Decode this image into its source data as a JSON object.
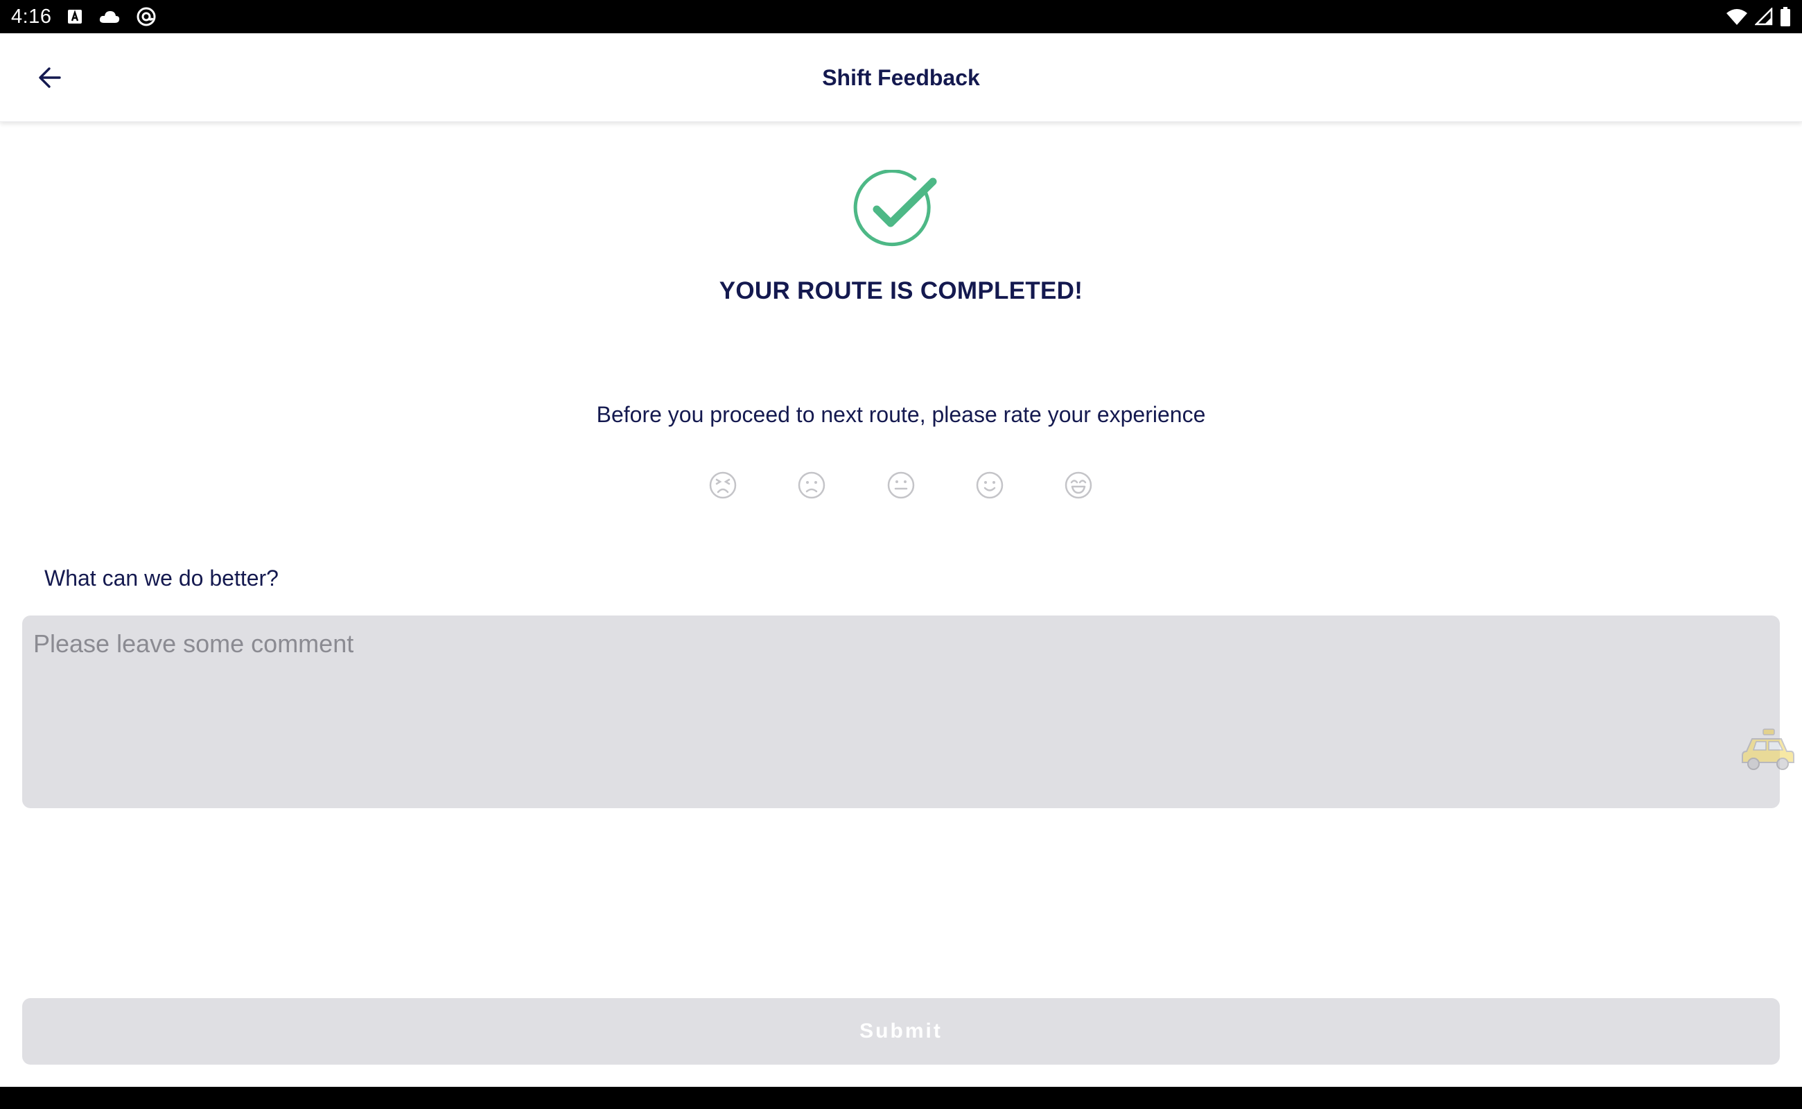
{
  "status_bar": {
    "time": "4:16",
    "left_icons": [
      "keyboard-a-icon",
      "cloud-icon",
      "at-sign-icon"
    ],
    "right_icons": [
      "wifi-icon",
      "signal-icon",
      "battery-icon"
    ]
  },
  "header": {
    "title": "Shift Feedback",
    "back_icon": "arrow-left-icon"
  },
  "completion": {
    "icon": "check-circle-icon",
    "icon_color": "#4db886",
    "title": "YOUR ROUTE IS COMPLETED!"
  },
  "rating": {
    "prompt": "Before you proceed to next route, please rate your experience",
    "faces": [
      "very-dissatisfied-icon",
      "dissatisfied-icon",
      "neutral-icon",
      "satisfied-icon",
      "very-satisfied-icon"
    ],
    "selected": null
  },
  "feedback": {
    "label": "What can we do better?",
    "placeholder": "Please leave some comment",
    "value": ""
  },
  "submit": {
    "label": "Submit",
    "enabled": false
  },
  "colors": {
    "text_primary": "#14194f",
    "accent_green": "#4db886",
    "input_bg": "#dfdfe3",
    "button_disabled_bg": "#dfdfe3"
  }
}
